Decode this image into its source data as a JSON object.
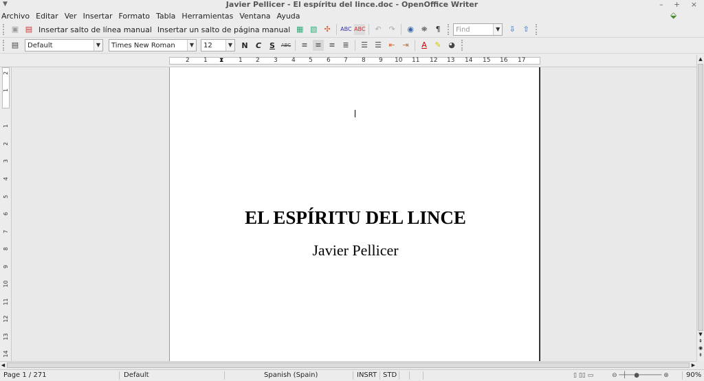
{
  "window": {
    "title": "Javier Pellicer - El espíritu del lince.doc - OpenOffice Writer",
    "controls": "– + ×"
  },
  "menu": [
    "Archivo",
    "Editar",
    "Ver",
    "Insertar",
    "Formato",
    "Tabla",
    "Herramientas",
    "Ventana",
    "Ayuda"
  ],
  "toolbar": {
    "line_break": "Insertar salto de línea manual",
    "page_break": "Insertar un salto de página manual",
    "find_placeholder": "Find"
  },
  "format": {
    "style": "Default",
    "font": "Times New Roman",
    "size": "12",
    "bold": "N",
    "italic": "C",
    "underline": "S"
  },
  "ruler": {
    "h": [
      "2",
      "1",
      "1",
      "2",
      "3",
      "4",
      "5",
      "6",
      "7",
      "8",
      "9",
      "10",
      "11",
      "12",
      "13",
      "14",
      "15",
      "16",
      "17"
    ],
    "v": [
      "2",
      "1",
      "1",
      "1",
      "2",
      "3",
      "4",
      "5",
      "6",
      "7",
      "8",
      "9",
      "10",
      "11",
      "12",
      "13",
      "14"
    ]
  },
  "document": {
    "title": "EL ESPÍRITU DEL LINCE",
    "author": "Javier Pellicer"
  },
  "status": {
    "page": "Page 1 / 271",
    "style": "Default",
    "language": "Spanish (Spain)",
    "mode": "INSRT",
    "selection": "STD",
    "zoom": "90%"
  }
}
